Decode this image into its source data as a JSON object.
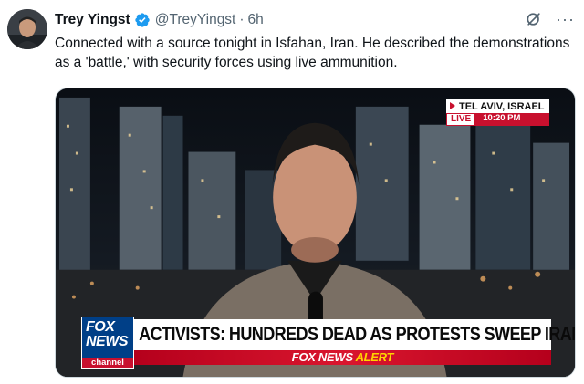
{
  "tweet": {
    "author_name": "Trey Yingst",
    "handle": "@TreyYingst",
    "separator": "·",
    "time": "6h",
    "more_label": "···",
    "text": "Connected with a source tonight in Isfahan, Iran. He described the demonstrations as a 'battle,' with security forces using live ammunition."
  },
  "media": {
    "location": "TEL AVIV, ISRAEL",
    "live_label": "LIVE",
    "live_time": "10:20 PM",
    "network_logo_lines": [
      "FOX",
      "NEWS",
      "channel"
    ],
    "headline": "ACTIVISTS: HUNDREDS DEAD AS PROTESTS SWEEP IRAN",
    "alert_prefix": "FOX NEWS",
    "alert_word": "ALERT"
  },
  "colors": {
    "verified_blue": "#1d9bf0",
    "fox_red": "#c8102e",
    "fox_blue": "#003f87",
    "alert_yellow": "#ffd400"
  },
  "icons": {
    "verified": "verified-badge-icon",
    "grok": "grok-icon",
    "more": "more-icon"
  }
}
